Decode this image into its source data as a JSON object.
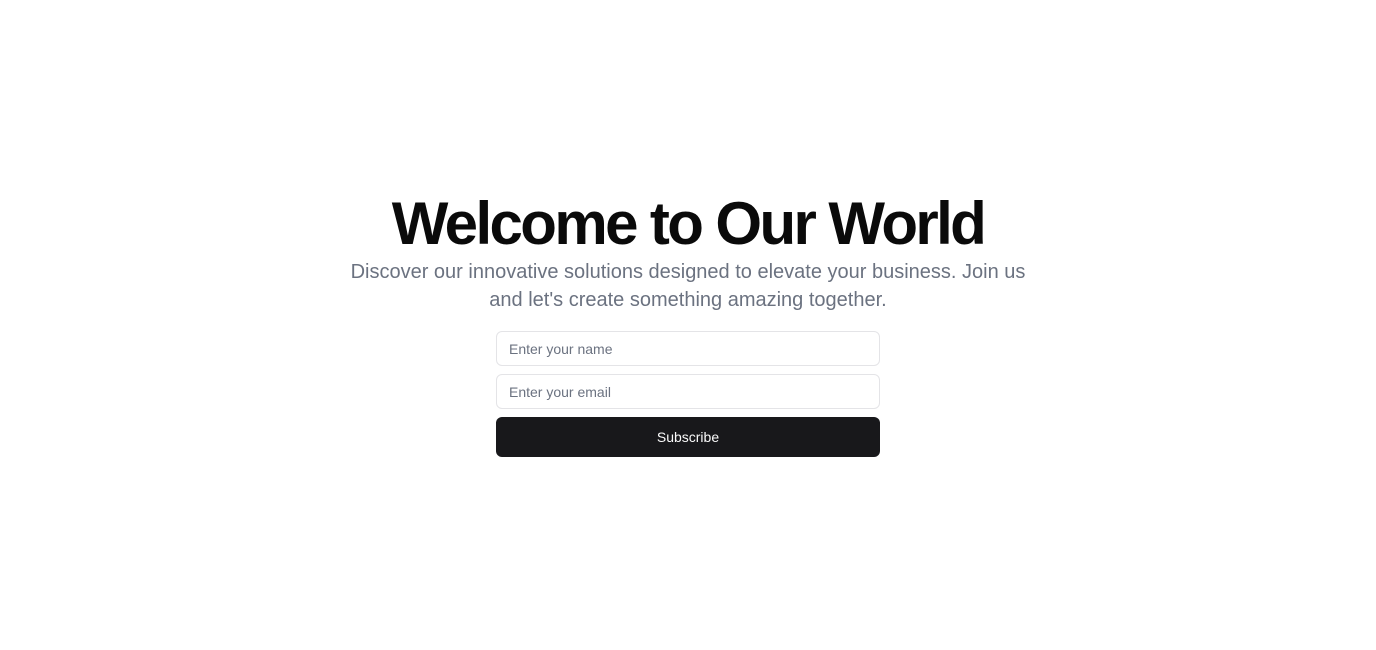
{
  "hero": {
    "title": "Welcome to Our World",
    "subtitle": "Discover our innovative solutions designed to elevate your business. Join us and let's create something amazing together."
  },
  "form": {
    "name_input": {
      "value": "",
      "placeholder": "Enter your name"
    },
    "email_input": {
      "value": "",
      "placeholder": "Enter your email"
    },
    "submit_label": "Subscribe"
  },
  "colors": {
    "background": "#ffffff",
    "title": "#0a0a0a",
    "subtitle": "#6b7280",
    "input_border": "#e4e4e7",
    "button_background": "#18181b",
    "button_text": "#fafafa"
  }
}
